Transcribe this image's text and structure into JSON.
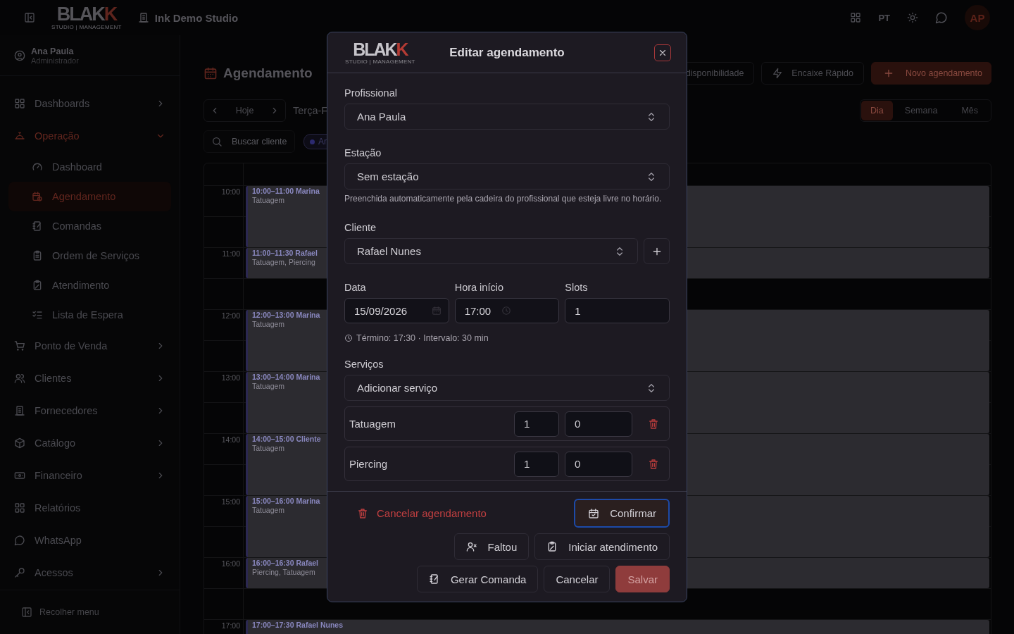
{
  "topbar": {
    "logo": {
      "main": "BLAK",
      "accent": "K",
      "tagline": "STUDIO | MANAGEMENT"
    },
    "studio": "Ink Demo Studio",
    "language": "PT",
    "avatar": "AP"
  },
  "sidebar": {
    "user": {
      "name": "Ana Paula",
      "role": "Administrador"
    },
    "items": [
      {
        "label": "Dashboards",
        "kind": "group",
        "expanded": false,
        "selected": false
      },
      {
        "label": "Operação",
        "kind": "group",
        "expanded": true,
        "selected": true,
        "children": [
          {
            "label": "Dashboard",
            "selected": false
          },
          {
            "label": "Agendamento",
            "selected": true
          },
          {
            "label": "Comandas",
            "selected": false
          },
          {
            "label": "Ordem de Serviços",
            "selected": false
          },
          {
            "label": "Atendimento",
            "selected": false
          },
          {
            "label": "Lista de Espera",
            "selected": false
          }
        ]
      },
      {
        "label": "Ponto de Venda",
        "kind": "group",
        "expanded": false,
        "selected": false
      },
      {
        "label": "Clientes",
        "kind": "group",
        "expanded": false,
        "selected": false
      },
      {
        "label": "Fornecedores",
        "kind": "group",
        "expanded": false,
        "selected": false
      },
      {
        "label": "Catálogo",
        "kind": "group",
        "expanded": false,
        "selected": false
      },
      {
        "label": "Financeiro",
        "kind": "group",
        "expanded": false,
        "selected": false
      },
      {
        "label": "Relatórios",
        "kind": "link",
        "selected": false
      },
      {
        "label": "WhatsApp",
        "kind": "link",
        "selected": false
      },
      {
        "label": "Acessos",
        "kind": "group",
        "expanded": false,
        "selected": false
      }
    ],
    "collapse": "Recolher menu"
  },
  "page": {
    "title": "Agendamento",
    "actions": [
      {
        "label": "disponibilidade",
        "kind": "outline"
      },
      {
        "label": "Encaixe Rápido",
        "kind": "quick"
      },
      {
        "label": "Novo agendamento",
        "kind": "primary"
      }
    ],
    "today": "Hoje",
    "date": "Terça-F",
    "views": [
      {
        "label": "Dia",
        "selected": true
      },
      {
        "label": "Semana",
        "selected": false
      },
      {
        "label": "Mês",
        "selected": false
      }
    ],
    "search": {
      "placeholder": "Buscar cliente"
    },
    "filter_chip": "An"
  },
  "calendar": {
    "hours": [
      {
        "time": "10:00",
        "event": {
          "kind": "hour",
          "title": "10:00–11:00 Marina",
          "services": "Tatuagem"
        }
      },
      {
        "time": "11:00",
        "event": {
          "kind": "half",
          "title": "11:00–11:30 Rafael",
          "services": "Tatuagem, Piercing"
        }
      },
      {
        "time": "12:00",
        "event": {
          "kind": "hour",
          "title": "12:00–13:00 Marina",
          "services": "Tatuagem"
        }
      },
      {
        "time": "13:00",
        "event": {
          "kind": "hour",
          "title": "13:00–14:00 Marina",
          "services": "Tatuagem"
        }
      },
      {
        "time": "14:00",
        "event": {
          "kind": "hour",
          "title": "14:00–15:00 Cliente",
          "services": "Tatuagem"
        }
      },
      {
        "time": "15:00",
        "event": {
          "kind": "hour",
          "title": "15:00–16:00 Marina",
          "services": "Tatuagem"
        }
      },
      {
        "time": "16:00",
        "event": {
          "kind": "half",
          "title": "16:00–16:30 Rafael",
          "services": "Piercing, Tatuagem"
        }
      },
      {
        "time": "17:00",
        "event": {
          "kind": "half",
          "title": "17:00–17:30 Rafael Nunes"
        }
      }
    ]
  },
  "modal": {
    "logo": {
      "main": "BLAK",
      "accent": "K",
      "tagline": "STUDIO | MANAGEMENT"
    },
    "title": "Editar agendamento",
    "professional": {
      "label": "Profissional",
      "value": "Ana Paula"
    },
    "station": {
      "label": "Estação",
      "value": "Sem estação",
      "hint": "Preenchida automaticamente pela cadeira do profissional que esteja livre no horário."
    },
    "client": {
      "label": "Cliente",
      "value": "Rafael Nunes"
    },
    "date": {
      "label": "Data",
      "value": "15/09/2026"
    },
    "time": {
      "label": "Hora início",
      "value": "17:00"
    },
    "slots": {
      "label": "Slots",
      "value": "1"
    },
    "summary": "Término: 17:30 · Intervalo: 30 min",
    "services": {
      "label": "Serviços",
      "value": "Adicionar serviço",
      "items": [
        {
          "name": "Tatuagem",
          "quantity": "1",
          "price": "0"
        },
        {
          "name": "Piercing",
          "quantity": "1",
          "price": "0"
        }
      ]
    },
    "cancel_appointment": "Cancelar agendamento",
    "confirm": {
      "label": "Confirmar",
      "focused": true
    },
    "no_show": "Faltou",
    "start": "Iniciar atendimento",
    "ticket": "Gerar Comanda",
    "cancel": "Cancelar",
    "save": "Salvar"
  }
}
